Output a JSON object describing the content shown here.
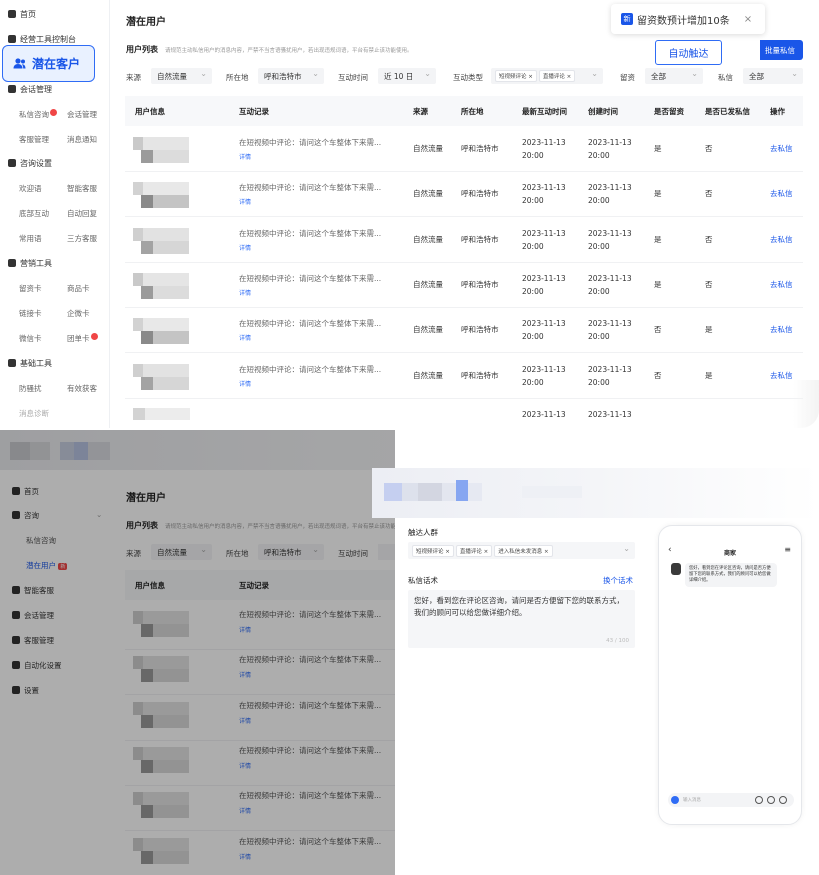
{
  "top": {
    "sidebar": {
      "items": [
        {
          "label": "首页",
          "icon": "home-icon"
        },
        {
          "label": "经营工具控制台",
          "icon": "dashboard-icon"
        },
        {
          "label": "潜在客户",
          "icon": "people-icon"
        },
        {
          "label": "会话管理",
          "icon": "chat-icon"
        },
        {
          "label": "咨询设置",
          "icon": "user-settings-icon"
        },
        {
          "label": "营销工具",
          "icon": "marketing-icon"
        },
        {
          "label": "基础工具",
          "icon": "tools-icon"
        }
      ],
      "subs": [
        "私信咨询",
        "会话管理",
        "客服管理",
        "消息通知",
        "欢迎语",
        "智能客服",
        "底部互动",
        "自动回复",
        "常用语",
        "三方客服",
        "留资卡",
        "商品卡",
        "链接卡",
        "企微卡",
        "微信卡",
        "团单卡",
        "防骚扰",
        "有效获客",
        "消息诊断"
      ]
    },
    "page_title": "潜在用户",
    "list_title": "用户列表",
    "list_desc": "请规范主动私信用户的消息内容，严禁不当言语骚扰用户，若出现违规词语，平台有禁止该功能使用。",
    "toast": {
      "badge": "新",
      "text": "留资数预计增加10条",
      "close": "×"
    },
    "auto_button": "自动触达",
    "bulk_button": "批量私信",
    "filters": [
      {
        "label": "来源",
        "value": "自然流量"
      },
      {
        "label": "所在地",
        "value": "呼和浩特市"
      },
      {
        "label": "互动时间",
        "value": "近 10 日"
      },
      {
        "label": "互动类型",
        "tags": [
          "短视频评论",
          "直播评论"
        ]
      },
      {
        "label": "留资",
        "value": "全部"
      },
      {
        "label": "私信",
        "value": "全部"
      }
    ],
    "columns": [
      "用户信息",
      "互动记录",
      "来源",
      "所在地",
      "最新互动时间",
      "创建时间",
      "是否留资",
      "是否已发私信",
      "操作"
    ],
    "rows": [
      {
        "record": "在短视频中评论：请问这个车整体下来需...",
        "detail": "详情",
        "source": "自然流量",
        "loc": "呼和浩特市",
        "latest": [
          "2023-11-13",
          "20:00"
        ],
        "created": [
          "2023-11-13",
          "20:00"
        ],
        "lead": "是",
        "sent": "否",
        "action": "去私信"
      },
      {
        "record": "在短视频中评论：请问这个车整体下来需...",
        "detail": "详情",
        "source": "自然流量",
        "loc": "呼和浩特市",
        "latest": [
          "2023-11-13",
          "20:00"
        ],
        "created": [
          "2023-11-13",
          "20:00"
        ],
        "lead": "是",
        "sent": "否",
        "action": "去私信"
      },
      {
        "record": "在短视频中评论：请问这个车整体下来需...",
        "detail": "详情",
        "source": "自然流量",
        "loc": "呼和浩特市",
        "latest": [
          "2023-11-13",
          "20:00"
        ],
        "created": [
          "2023-11-13",
          "20:00"
        ],
        "lead": "是",
        "sent": "否",
        "action": "去私信"
      },
      {
        "record": "在短视频中评论：请问这个车整体下来需...",
        "detail": "详情",
        "source": "自然流量",
        "loc": "呼和浩特市",
        "latest": [
          "2023-11-13",
          "20:00"
        ],
        "created": [
          "2023-11-13",
          "20:00"
        ],
        "lead": "是",
        "sent": "否",
        "action": "去私信"
      },
      {
        "record": "在短视频中评论：请问这个车整体下来需...",
        "detail": "详情",
        "source": "自然流量",
        "loc": "呼和浩特市",
        "latest": [
          "2023-11-13",
          "20:00"
        ],
        "created": [
          "2023-11-13",
          "20:00"
        ],
        "lead": "否",
        "sent": "是",
        "action": "去私信"
      },
      {
        "record": "在短视频中评论：请问这个车整体下来需...",
        "detail": "详情",
        "source": "自然流量",
        "loc": "呼和浩特市",
        "latest": [
          "2023-11-13",
          "20:00"
        ],
        "created": [
          "2023-11-13",
          "20:00"
        ],
        "lead": "否",
        "sent": "是",
        "action": "去私信"
      }
    ],
    "partial_row": {
      "latest": "2023-11-13",
      "created": "2023-11-13"
    }
  },
  "bottom": {
    "sidebar": {
      "items": [
        {
          "label": "首页",
          "icon": "home-icon"
        },
        {
          "label": "咨询",
          "icon": "consult-icon"
        },
        {
          "label": "智能客服",
          "icon": "robot-icon"
        },
        {
          "label": "会话管理",
          "icon": "chat-icon"
        },
        {
          "label": "客服管理",
          "icon": "agent-icon"
        },
        {
          "label": "自动化设置",
          "icon": "automation-icon"
        },
        {
          "label": "设置",
          "icon": "settings-icon"
        }
      ],
      "subs": [
        "私信咨询",
        "潜在用户"
      ],
      "new_badge": "新"
    },
    "page_title": "潜在用户",
    "list_title": "用户列表",
    "list_desc": "请规范主动私信用户的消息内容，严禁不当言语骚扰用户，若出现违规词语，平台有禁止该功能使用。",
    "filters": [
      {
        "label": "来源",
        "value": "自然流量"
      },
      {
        "label": "所在地",
        "value": "呼和浩特市"
      },
      {
        "label": "互动时间",
        "value": ""
      }
    ],
    "columns": [
      "用户信息",
      "互动记录"
    ],
    "rows": [
      {
        "record": "在短视频中评论：请问这个车整体下来需...",
        "detail": "详情"
      },
      {
        "record": "在短视频中评论：请问这个车整体下来需...",
        "detail": "详情"
      },
      {
        "record": "在短视频中评论：请问这个车整体下来需...",
        "detail": "详情"
      },
      {
        "record": "在短视频中评论：请问这个车整体下来需...",
        "detail": "详情"
      },
      {
        "record": "在短视频中评论：请问这个车整体下来需...",
        "detail": "详情"
      },
      {
        "record": "在短视频中评论：请问这个车整体下来需...",
        "detail": "详情"
      }
    ],
    "drawer": {
      "audience_label": "触达人群",
      "audience_tags": [
        "短视频评论",
        "直播评论",
        "进入私信未发消息"
      ],
      "script_label": "私信话术",
      "change_script": "换个话术",
      "script_text": "您好，看到您在评论区咨询，请问是否方便留下您的联系方式，我们的顾问可以给您做详细介绍。",
      "counter": "43 / 100"
    },
    "phone": {
      "title": "商家",
      "back": "‹",
      "menu": "≡",
      "bubble": "您好，看到您在评论区咨询，请问是否方便留下您的联系方式，我们的顾问可以给您做详细介绍。",
      "input_placeholder": "输入消息"
    }
  },
  "colors": {
    "accent": "#1a56e8",
    "danger": "#f04646",
    "overlay": "rgba(0,0,0,0.32)"
  }
}
